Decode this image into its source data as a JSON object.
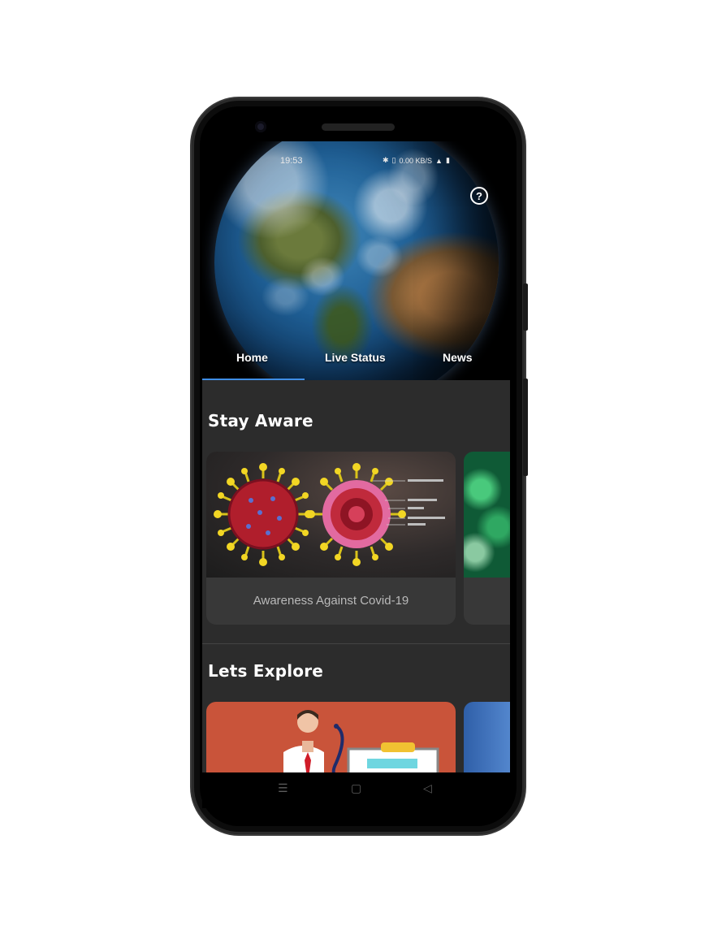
{
  "status_bar": {
    "time": "19:53",
    "icons": [
      "bluetooth-icon",
      "vibrate-icon",
      "signal-icon",
      "wifi-icon",
      "battery-icon"
    ],
    "speed": "0.00 KB/S"
  },
  "header": {
    "help_icon": "question-circle-icon",
    "help_glyph": "?"
  },
  "tabs": [
    {
      "label": "Home",
      "selected": true
    },
    {
      "label": "Live Status",
      "selected": false
    },
    {
      "label": "News",
      "selected": false
    }
  ],
  "colors": {
    "accent": "#3f8ee6",
    "background": "#2c2c2c",
    "card": "#383838"
  },
  "sections": {
    "stay_aware": {
      "title": "Stay Aware",
      "cards": [
        {
          "caption": "Awareness Against Covid-19",
          "image": "coronavirus-diagram"
        },
        {
          "caption": "",
          "image": "green-virus"
        }
      ]
    },
    "lets_explore": {
      "title": "Lets Explore",
      "cards": [
        {
          "image": "doctor-illustration"
        },
        {
          "image": "blue-card"
        }
      ]
    }
  },
  "nav": {
    "menu_glyph": "☰",
    "home_glyph": "▢",
    "back_glyph": "◁"
  }
}
